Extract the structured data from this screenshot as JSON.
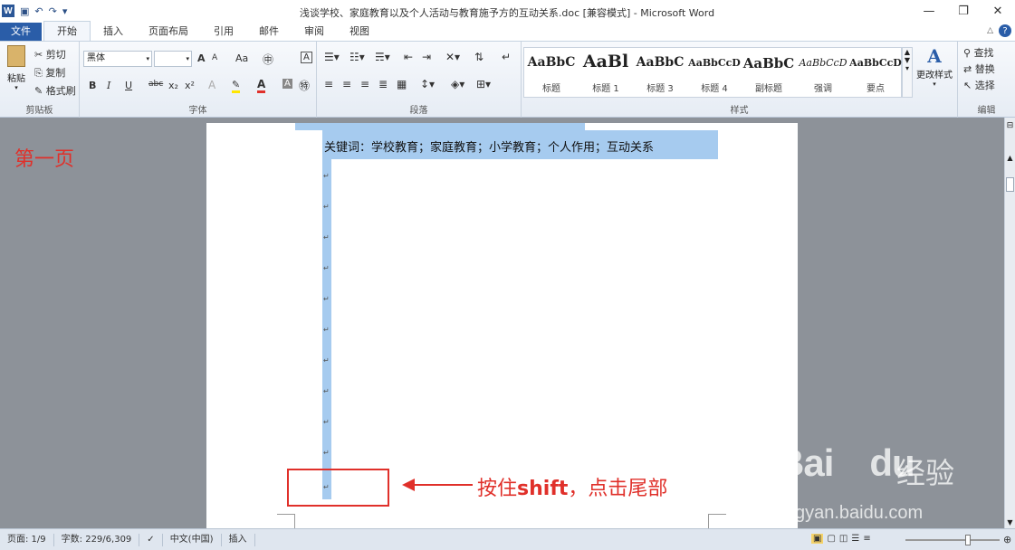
{
  "app": {
    "title": "浅谈学校、家庭教育以及个人活动与教育施予方的互动关系.doc [兼容模式] - Microsoft Word",
    "logo_letter": "W"
  },
  "quick_access": {
    "save_icon": "save-icon",
    "undo_icon": "undo-icon",
    "redo_icon": "redo-icon"
  },
  "window_controls": {
    "minimize": "—",
    "restore": "❐",
    "close": "✕"
  },
  "tabs": [
    {
      "label": "文件",
      "kind": "file"
    },
    {
      "label": "开始",
      "kind": "active"
    },
    {
      "label": "插入"
    },
    {
      "label": "页面布局"
    },
    {
      "label": "引用"
    },
    {
      "label": "邮件"
    },
    {
      "label": "审阅"
    },
    {
      "label": "视图"
    }
  ],
  "clipboard": {
    "paste": "粘贴",
    "cut": "剪切",
    "copy": "复制",
    "format_painter": "格式刷",
    "label": "剪贴板"
  },
  "font": {
    "name": "黑体",
    "size": "",
    "grow": "A",
    "shrink": "A",
    "case": "Aa",
    "bold": "B",
    "italic": "I",
    "underline": "U",
    "strike": "abc",
    "subscript": "x₂",
    "superscript": "x²",
    "label": "字体"
  },
  "paragraph": {
    "label": "段落"
  },
  "styles": {
    "items": [
      {
        "sample": "AaBbC",
        "name": "标题"
      },
      {
        "sample": "AaBl",
        "name": "标题 1"
      },
      {
        "sample": "AaBbC",
        "name": "标题 3"
      },
      {
        "sample": "AaBbCcD",
        "name": "标题 4"
      },
      {
        "sample": "AaBbC",
        "name": "副标题"
      },
      {
        "sample": "AaBbCcD",
        "name": "强调"
      },
      {
        "sample": "AaBbCcD",
        "name": "要点"
      }
    ],
    "change_styles": "更改样式",
    "label": "样式"
  },
  "editing": {
    "find": "查找",
    "replace": "替换",
    "select": "选择",
    "label": "编辑"
  },
  "document": {
    "keywords_line": "关键词：学校教育；家庭教育；小学教育；个人作用；互动关系",
    "paragraph_mark": "↵"
  },
  "annotations": {
    "page_label": "第一页",
    "instruction_prefix": "按住",
    "instruction_key": "shift",
    "instruction_suffix": "，点击尾部"
  },
  "status": {
    "page": "页面: 1/9",
    "words": "字数: 229/6,309",
    "language": "中文(中国)",
    "mode": "插入"
  },
  "watermark": {
    "logo": "Bai",
    "logo2": "du",
    "cn": "经验",
    "url": "jingyan.baidu.com"
  },
  "colors": {
    "accent": "#2a5da8",
    "annotation": "#e0302a",
    "selection": "#a6cbef"
  }
}
